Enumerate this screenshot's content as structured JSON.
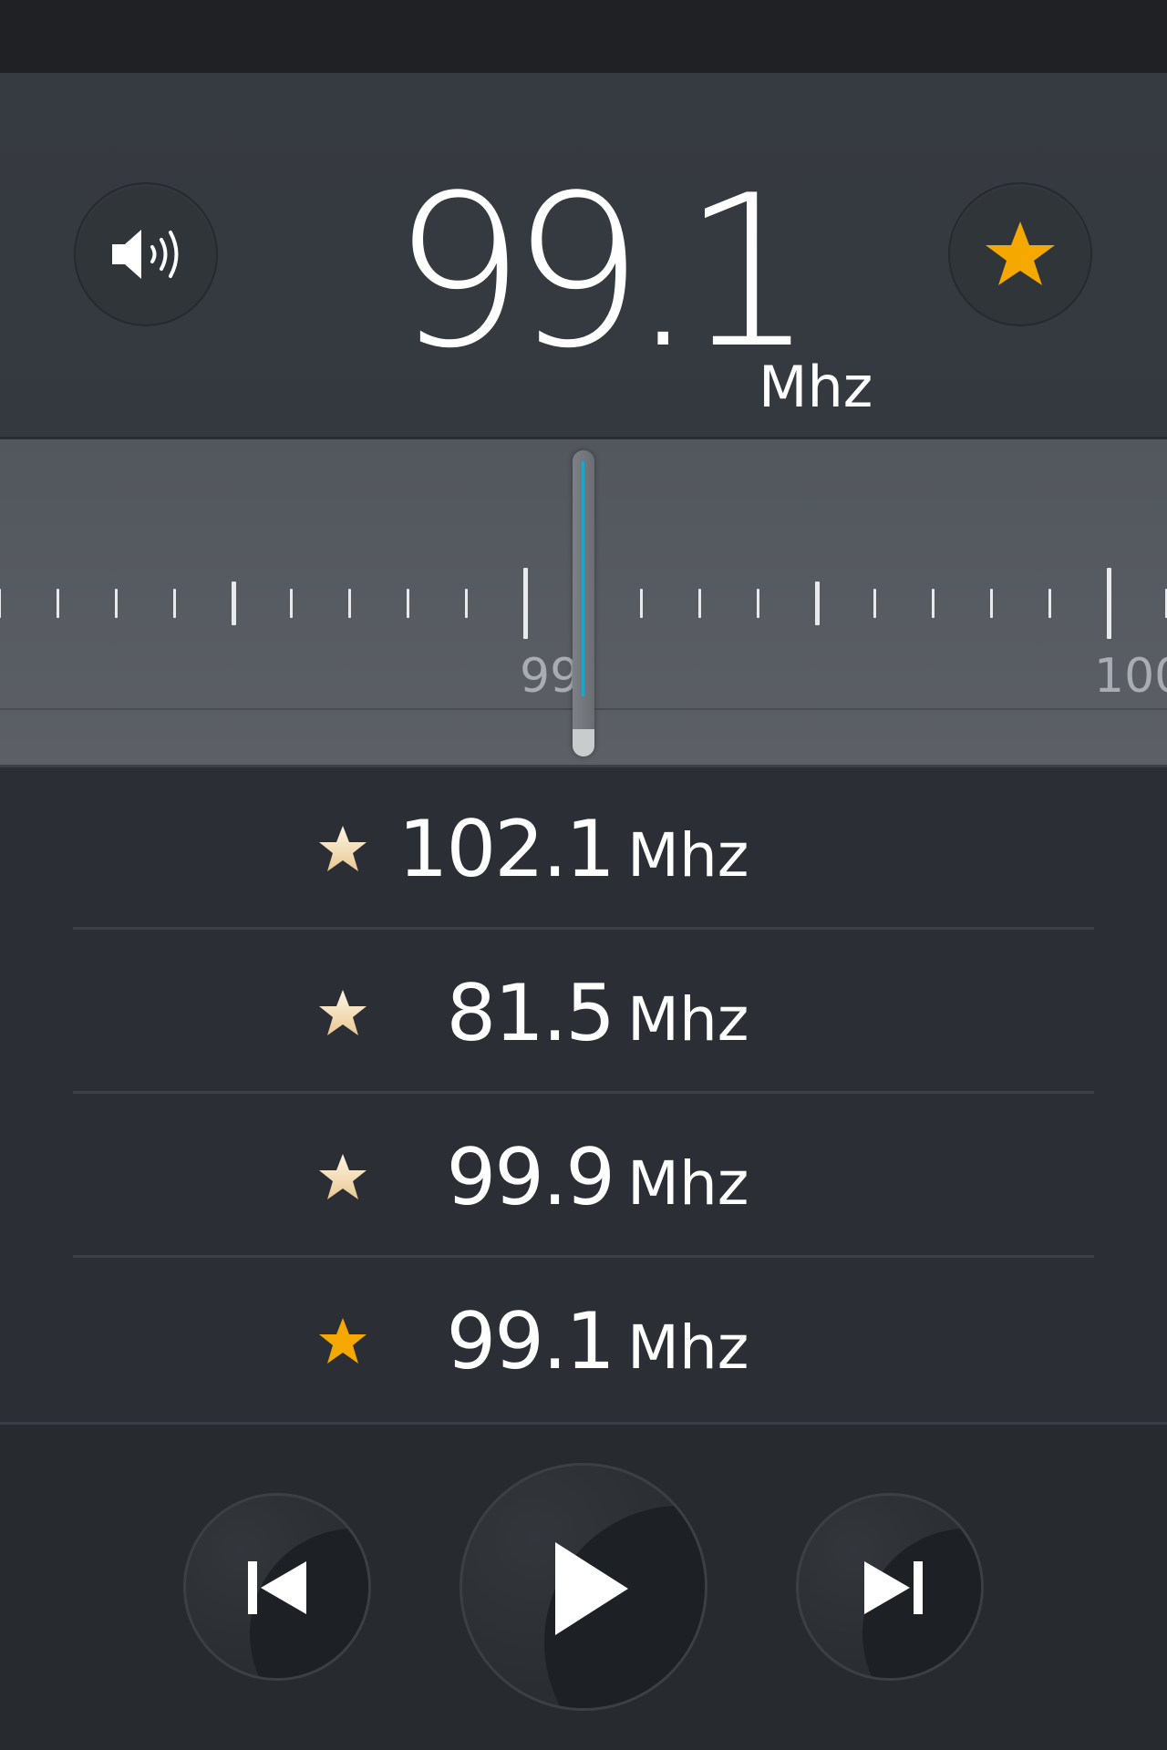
{
  "header": {
    "current_frequency": "99.1",
    "unit": "Mhz",
    "volume_icon": "volume-icon",
    "favorite_icon": "star-icon",
    "favorite_active": true,
    "accent_color": "#f5a800"
  },
  "tuner": {
    "labels": [
      "99",
      "100"
    ],
    "needle_color": "#1aa7c9",
    "tuned_value": 99.1
  },
  "favorites": {
    "items": [
      {
        "frequency": "102.1",
        "unit": "Mhz",
        "active": false
      },
      {
        "frequency": "81.5",
        "unit": "Mhz",
        "active": false
      },
      {
        "frequency": "99.9",
        "unit": "Mhz",
        "active": false
      },
      {
        "frequency": "99.1",
        "unit": "Mhz",
        "active": true
      }
    ]
  },
  "controls": {
    "previous_icon": "skip-previous-icon",
    "play_icon": "play-icon",
    "next_icon": "skip-next-icon"
  }
}
